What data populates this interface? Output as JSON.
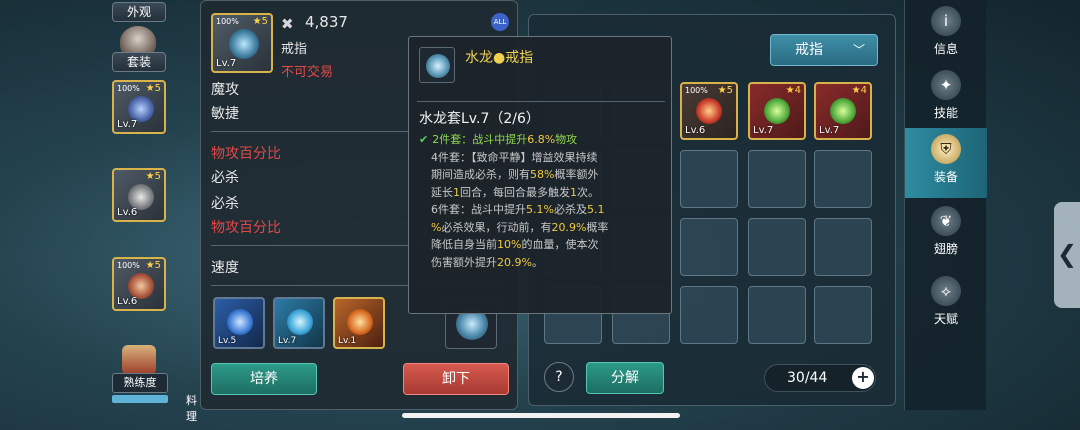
{
  "left_column": {
    "appearance_label": "外观",
    "suit_label": "套装",
    "slots": [
      {
        "pct": "100%",
        "stars": "5",
        "level": "Lv.7"
      },
      {
        "pct": "",
        "stars": "5",
        "level": "Lv.6"
      },
      {
        "pct": "100%",
        "stars": "5",
        "level": "Lv.6"
      }
    ],
    "proficiency_label": "熟练度",
    "cooking_label": "料理"
  },
  "detail": {
    "item_pct": "100%",
    "item_stars": "5",
    "item_level": "Lv.7",
    "power_icon": "crossed-swords-icon",
    "power": "4,837",
    "all_badge": "ALL",
    "item_type": "戒指",
    "no_trade": "不可交易",
    "stats": [
      "魔攻",
      "敏捷",
      "物攻百分比",
      "必杀",
      "必杀",
      "物攻百分比",
      "速度"
    ],
    "gems": [
      {
        "level": "Lv.5"
      },
      {
        "level": "Lv.7"
      },
      {
        "level": "Lv.1"
      }
    ],
    "cultivate_button": "培养",
    "unequip_button": "卸下"
  },
  "tooltip": {
    "title_name": "水龙",
    "title_dot": "●",
    "title_type": "戒指",
    "set_name": "水龙套Lv.7（2/6）",
    "bonus2_prefix": "2件套：战斗中提升",
    "bonus2_value": "6.8%",
    "bonus2_suffix": "物攻",
    "bonus4_line1": "4件套：【致命平静】增益效果持续",
    "bonus4_line2_a": "期间造成必杀，则有",
    "bonus4_line2_value": "58%",
    "bonus4_line2_b": "概率额外",
    "bonus4_line3_a": "延长",
    "bonus4_line3_value1": "1",
    "bonus4_line3_b": "回合，每回合最多触发",
    "bonus4_line3_value2": "1",
    "bonus4_line3_c": "次。",
    "bonus6_line1_a": "6件套：战斗中提升",
    "bonus6_line1_value1": "5.1%",
    "bonus6_line1_b": "必杀及",
    "bonus6_line1_value2": "5.1",
    "bonus6_line2_a": "%",
    "bonus6_line2_b": "必杀效果，行动前，有",
    "bonus6_line2_value": "20.9%",
    "bonus6_line2_c": "概率",
    "bonus6_line3_a": "降低自身当前",
    "bonus6_line3_value": "10%",
    "bonus6_line3_b": "的血量，使本次",
    "bonus6_line4_a": "伤害额外提升",
    "bonus6_line4_value": "20.9%",
    "bonus6_line4_b": "。"
  },
  "bag": {
    "filter_label": "戒指",
    "items": [
      {
        "pct": "100%",
        "stars": "5",
        "level": "Lv.6"
      },
      {
        "pct": "",
        "stars": "4",
        "level": "Lv.7"
      },
      {
        "pct": "",
        "stars": "4",
        "level": "Lv.7"
      }
    ],
    "help_label": "?",
    "decompose_button": "分解",
    "capacity": "30/44",
    "add_label": "+"
  },
  "nav": {
    "items": [
      {
        "label": "信息",
        "icon": "info-icon",
        "glyph": "i"
      },
      {
        "label": "技能",
        "icon": "skill-icon",
        "glyph": "✦"
      },
      {
        "label": "装备",
        "icon": "armor-icon",
        "glyph": "⛨"
      },
      {
        "label": "翅膀",
        "icon": "wing-icon",
        "glyph": "❦"
      },
      {
        "label": "天赋",
        "icon": "talent-icon",
        "glyph": "⟡"
      }
    ],
    "active_index": 2,
    "back_glyph": "❮"
  },
  "colors": {
    "gold_frame": "#d8b24a",
    "accent_teal": "#2d9a8a",
    "danger_red": "#e24848",
    "set_active_green": "#8fd94c",
    "highlight_yellow": "#f0c83c"
  }
}
